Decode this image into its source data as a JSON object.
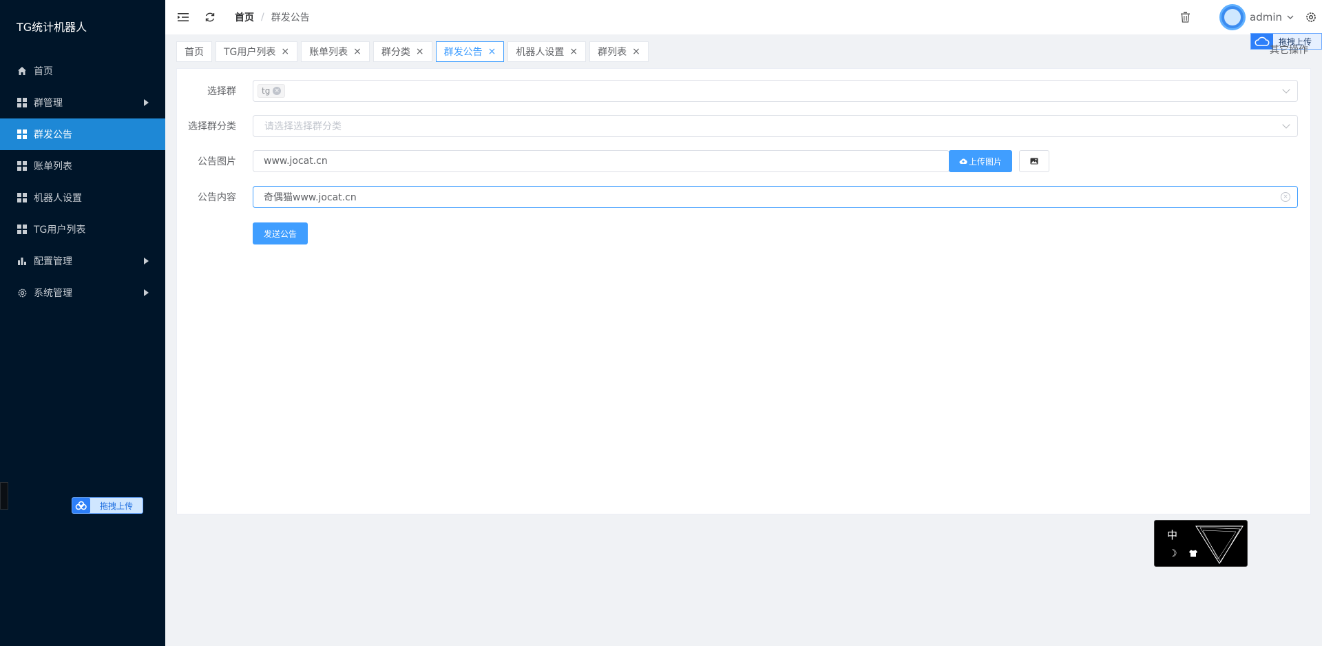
{
  "sidebar": {
    "brand": "TG统计机器人",
    "items": [
      {
        "label": "首页",
        "icon": "home-icon"
      },
      {
        "label": "群管理",
        "icon": "grid-icon",
        "has_children": true
      },
      {
        "label": "群发公告",
        "icon": "grid-icon",
        "active": true
      },
      {
        "label": "账单列表",
        "icon": "grid-icon"
      },
      {
        "label": "机器人设置",
        "icon": "grid-icon"
      },
      {
        "label": "TG用户列表",
        "icon": "grid-icon"
      },
      {
        "label": "配置管理",
        "icon": "bar-chart-icon",
        "has_children": true
      },
      {
        "label": "系统管理",
        "icon": "gear-icon",
        "has_children": true
      }
    ],
    "upload_label": "拖拽上传"
  },
  "header": {
    "breadcrumb_home": "首页",
    "breadcrumb_sep": "/",
    "breadcrumb_current": "群发公告",
    "username": "admin",
    "cloud_upload_label": "拖拽上传"
  },
  "tabs": [
    {
      "label": "首页",
      "closable": false
    },
    {
      "label": "TG用户列表",
      "closable": true
    },
    {
      "label": "账单列表",
      "closable": true
    },
    {
      "label": "群分类",
      "closable": true
    },
    {
      "label": "群发公告",
      "closable": true,
      "active": true
    },
    {
      "label": "机器人设置",
      "closable": true
    },
    {
      "label": "群列表",
      "closable": true
    }
  ],
  "tab_close_glyph": "×",
  "other_ops": "其它操作",
  "form": {
    "select_group_label": "选择群",
    "select_group_tag": "tg",
    "select_category_label": "选择群分类",
    "select_category_placeholder": "请选择选择群分类",
    "image_label": "公告图片",
    "image_value": "www.jocat.cn",
    "upload_button": "上传图片",
    "content_label": "公告内容",
    "content_value": "奇偶猫www.jocat.cn",
    "submit_button": "发送公告"
  },
  "widget": {
    "lang": "中"
  },
  "colors": {
    "sidebar_bg": "#001529",
    "active_menu": "#1e88d6",
    "primary": "#409eff"
  }
}
